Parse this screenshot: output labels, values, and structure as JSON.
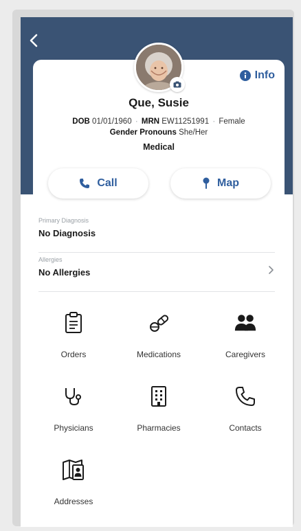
{
  "patient": {
    "name": "Que, Susie",
    "dob_label": "DOB",
    "dob": "01/01/1960",
    "mrn_label": "MRN",
    "mrn": "EW11251991",
    "sex": "Female",
    "pronouns_label": "Gender Pronouns",
    "pronouns": "She/Her",
    "program": "Medical"
  },
  "header": {
    "info_label": "Info"
  },
  "actions": {
    "call_label": "Call",
    "map_label": "Map"
  },
  "fields": {
    "diagnosis_label": "Primary Diagnosis",
    "diagnosis_value": "No Diagnosis",
    "allergies_label": "Allergies",
    "allergies_value": "No Allergies"
  },
  "tiles": [
    {
      "label": "Orders",
      "icon": "clipboard-icon"
    },
    {
      "label": "Medications",
      "icon": "pills-icon"
    },
    {
      "label": "Caregivers",
      "icon": "users-icon"
    },
    {
      "label": "Physicians",
      "icon": "stethoscope-icon"
    },
    {
      "label": "Pharmacies",
      "icon": "building-icon"
    },
    {
      "label": "Contacts",
      "icon": "phone-icon"
    },
    {
      "label": "Addresses",
      "icon": "map-contact-icon"
    }
  ],
  "colors": {
    "header_band": "#3a5374",
    "accent": "#2f5e9e"
  }
}
